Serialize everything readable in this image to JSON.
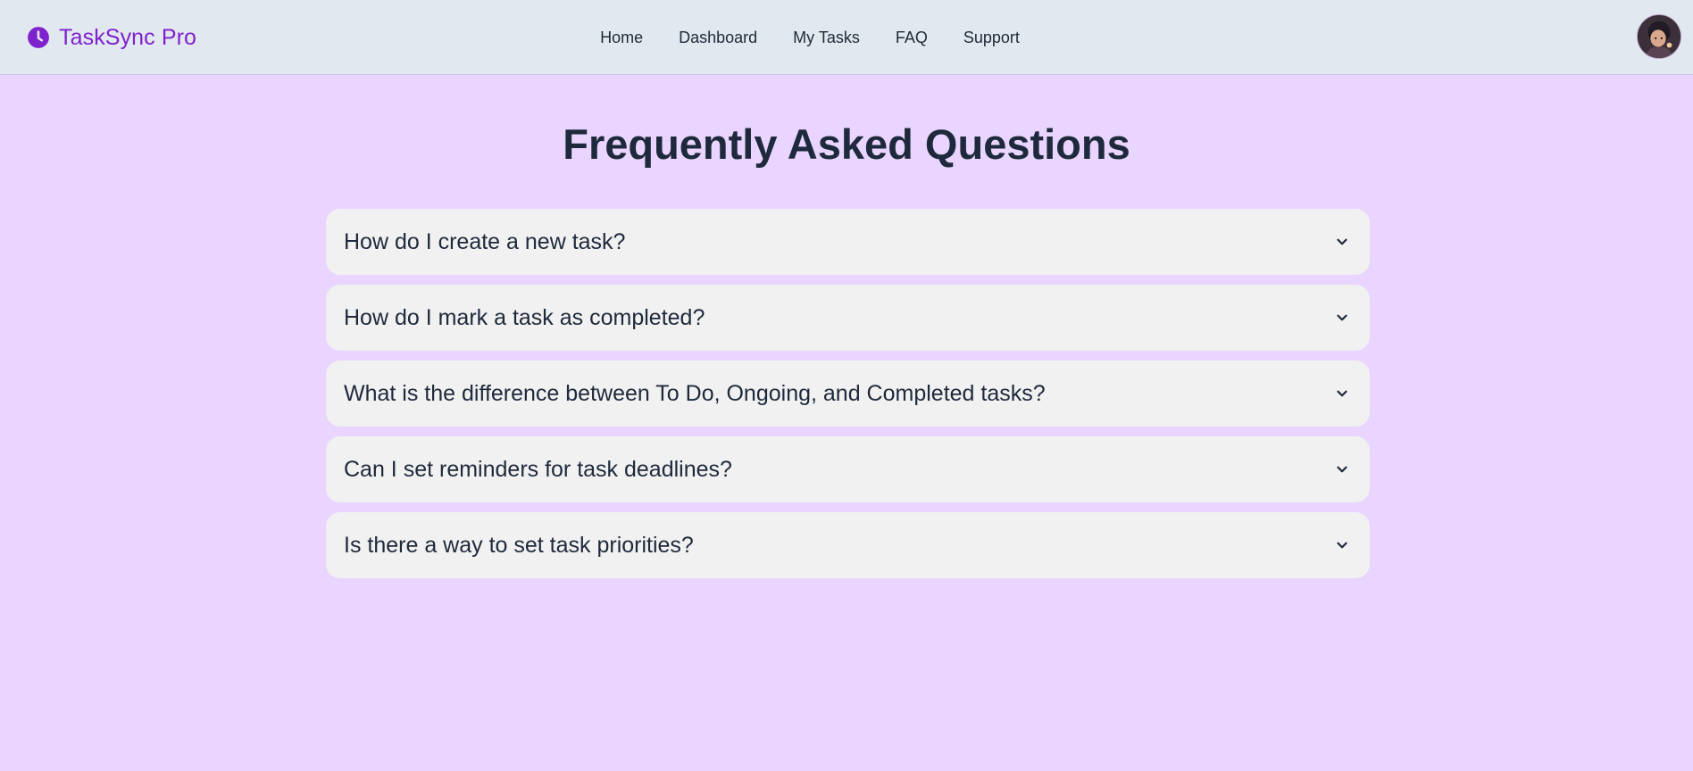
{
  "brand": {
    "name": "TaskSync Pro",
    "icon": "clock-icon",
    "color": "#7e22ce"
  },
  "nav": {
    "links": [
      "Home",
      "Dashboard",
      "My Tasks",
      "FAQ",
      "Support"
    ]
  },
  "user": {
    "avatar": "user-avatar"
  },
  "page": {
    "title": "Frequently Asked Questions",
    "background": "#e9d5ff"
  },
  "faq": {
    "items": [
      {
        "question": "How do I create a new task?",
        "icon": "chevron-down-icon",
        "expanded": false
      },
      {
        "question": "How do I mark a task as completed?",
        "icon": "chevron-down-icon",
        "expanded": false
      },
      {
        "question": "What is the difference between To Do, Ongoing, and Completed tasks?",
        "icon": "chevron-down-icon",
        "expanded": false
      },
      {
        "question": "Can I set reminders for task deadlines?",
        "icon": "chevron-down-icon",
        "expanded": false
      },
      {
        "question": "Is there a way to set task priorities?",
        "icon": "chevron-down-icon",
        "expanded": false
      }
    ]
  }
}
